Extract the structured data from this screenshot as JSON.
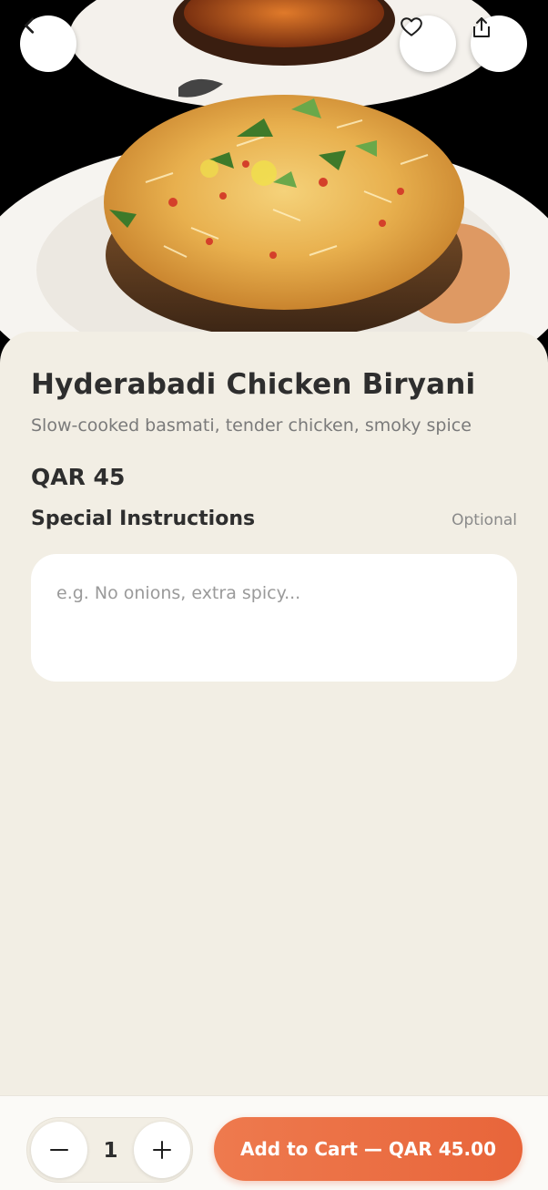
{
  "hero": {
    "image_alt": "Hyderabadi Chicken Biryani dish photo",
    "back_icon": "chevron-left-icon",
    "favorite_icon": "heart-icon",
    "share_icon": "share-icon"
  },
  "item": {
    "title": "Hyderabadi Chicken Biryani",
    "description": "Slow-cooked basmati, tender chicken, smoky spice",
    "price": "QAR 45"
  },
  "instructions": {
    "label": "Special Instructions",
    "optional_label": "Optional",
    "placeholder": "e.g. No onions, extra spicy...",
    "value": ""
  },
  "cart": {
    "quantity": "1",
    "add_label": "Add to Cart — QAR 45.00",
    "minus_icon": "minus-icon",
    "plus_icon": "plus-icon"
  },
  "colors": {
    "background": "#F2EEE4",
    "accent": "#E8653A",
    "text": "#2e2e2e"
  }
}
